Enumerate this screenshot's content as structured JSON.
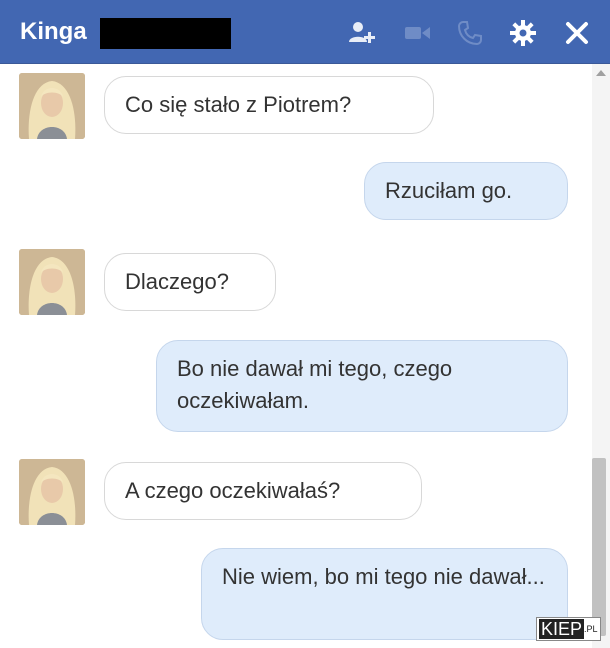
{
  "header": {
    "contact_name": "Kinga",
    "icons": [
      "add-friend-icon",
      "video-call-icon",
      "phone-icon",
      "gear-icon",
      "close-icon"
    ]
  },
  "messages": [
    {
      "from": "contact",
      "text": "Co się stało z Piotrem?"
    },
    {
      "from": "me",
      "text": "Rzuciłam go."
    },
    {
      "from": "contact",
      "text": "Dlaczego?"
    },
    {
      "from": "me",
      "text": "Bo nie dawał mi tego, czego oczekiwałam."
    },
    {
      "from": "contact",
      "text": "A czego oczekiwałaś?"
    },
    {
      "from": "me",
      "text": "Nie wiem, bo mi tego nie dawał..."
    }
  ],
  "watermark": {
    "brand": "KIEP",
    "suffix": ".PL"
  },
  "colors": {
    "header": "#4267b2",
    "outgoing_bubble": "#dfecfb",
    "incoming_bubble": "#ffffff"
  }
}
